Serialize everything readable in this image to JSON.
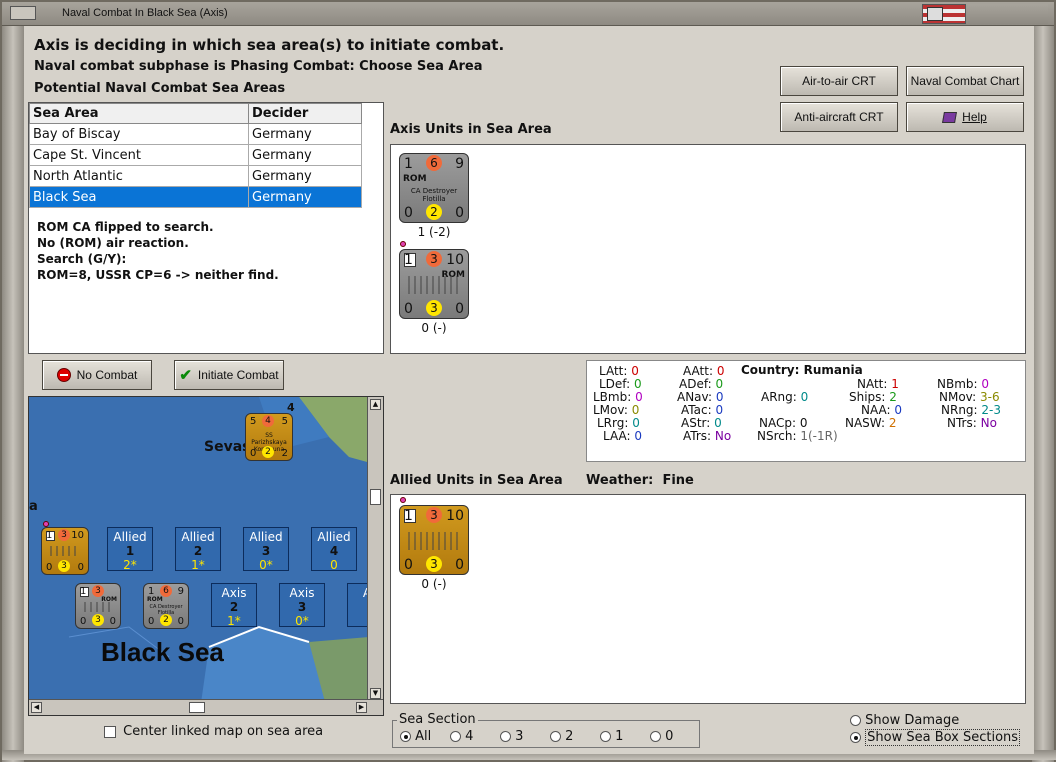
{
  "window": {
    "title": "Naval Combat In Black Sea (Axis)"
  },
  "headings": {
    "main": "Axis is deciding in which sea area(s) to initiate combat.",
    "subphase": "Naval combat subphase is Phasing Combat: Choose Sea Area",
    "potential": "Potential Naval Combat Sea Areas"
  },
  "sea_table": {
    "col_area": "Sea Area",
    "col_decider": "Decider",
    "rows": [
      {
        "area": "Bay of Biscay",
        "decider": "Germany"
      },
      {
        "area": "Cape St. Vincent",
        "decider": "Germany"
      },
      {
        "area": "North Atlantic",
        "decider": "Germany"
      },
      {
        "area": "Black Sea",
        "decider": "Germany"
      }
    ]
  },
  "log": {
    "line1": "ROM CA flipped to search.",
    "line2": "No (ROM) air reaction.",
    "line3": "Search (G/Y):",
    "line4": "ROM=8, USSR CP=6 -> neither find."
  },
  "buttons": {
    "air_to_air": "Air-to-air CRT",
    "naval_chart": "Naval Combat Chart",
    "anti_aircraft": "Anti-aircraft CRT",
    "help": "Help",
    "no_combat": "No Combat",
    "initiate": "Initiate Combat"
  },
  "axis_units": {
    "label": "Axis Units in Sea Area",
    "unit1": {
      "tl": "1",
      "red": "6",
      "tr": "9",
      "nat": "ROM",
      "name": "CA Destroyer Flotilla",
      "bl": "0",
      "yel": "2",
      "br": "0",
      "caption": "1 (-2)"
    },
    "unit2": {
      "tl": "1",
      "red": "3",
      "tr": "10",
      "nat": "ROM",
      "bl": "0",
      "yel": "3",
      "br": "0",
      "caption": "0 (-)"
    }
  },
  "stats": {
    "country_label": "Country:",
    "country": "Rumania",
    "LAtt": "0",
    "AAtt": "0",
    "LDef": "0",
    "ADef": "0",
    "LBmb": "0",
    "ANav": "0",
    "ARng": "0",
    "LMov": "0",
    "ATac": "0",
    "LRrg": "0",
    "AStr": "0",
    "NACp": "0",
    "LAA": "0",
    "ATrs": "No",
    "NSrch": "1(-1R)",
    "NAtt": "1",
    "NBmb": "0",
    "Ships": "2",
    "NMov": "3-6",
    "NAA": "0",
    "NRng": "2-3",
    "NASW": "2",
    "NTrs": "No"
  },
  "allied_units": {
    "label": "Allied Units in Sea Area",
    "weather_label": "Weather:",
    "weather": "Fine",
    "unit1": {
      "tl": "1",
      "red": "3",
      "tr": "10",
      "bl": "0",
      "yel": "3",
      "br": "0",
      "caption": "0 (-)"
    }
  },
  "map": {
    "sea_name": "Black Sea",
    "city": "Sevas",
    "left_letter": "a",
    "soviet_unit": {
      "tl": "5",
      "red": "4",
      "tr": "5",
      "top": "4",
      "name": "SS Parizhskaya Kommuna",
      "bl": "0",
      "yel": "2",
      "br": "2"
    },
    "allied_boxes": [
      {
        "label": "Allied",
        "num": "1",
        "sub": "2*"
      },
      {
        "label": "Allied",
        "num": "2",
        "sub": "1*"
      },
      {
        "label": "Allied",
        "num": "3",
        "sub": "0*"
      },
      {
        "label": "Allied",
        "num": "4",
        "sub": "0"
      }
    ],
    "axis_boxes": [
      {
        "label": "Axis",
        "num": "2",
        "sub": "1*"
      },
      {
        "label": "Axis",
        "num": "3",
        "sub": "0*"
      },
      {
        "label": "A",
        "num": "",
        "sub": ""
      }
    ],
    "map_unit_a": {
      "tl": "1",
      "red": "3",
      "tr": "10",
      "bl": "0",
      "yel": "3",
      "br": "0"
    },
    "map_unit_b": {
      "tl": "1",
      "red": "3",
      "nat": "ROM",
      "bl": "0",
      "yel": "3",
      "br": "0"
    },
    "map_unit_c": {
      "tl": "1",
      "red": "6",
      "tr": "9",
      "nat": "ROM",
      "name": "CA Destroyer Flotilla",
      "bl": "0",
      "yel": "2",
      "br": "0"
    }
  },
  "center_map": "Center linked map on sea area",
  "sea_section": {
    "label": "Sea Section",
    "options": [
      "All",
      "4",
      "3",
      "2",
      "1",
      "0"
    ],
    "selected": "All"
  },
  "show_damage": "Show Damage",
  "show_sections": "Show Sea Box Sections",
  "colors": {
    "selection": "#0a74d6",
    "sea": "#3a6fb0",
    "red_circle": "#f06a3a",
    "yellow_circle": "#ffe600"
  }
}
